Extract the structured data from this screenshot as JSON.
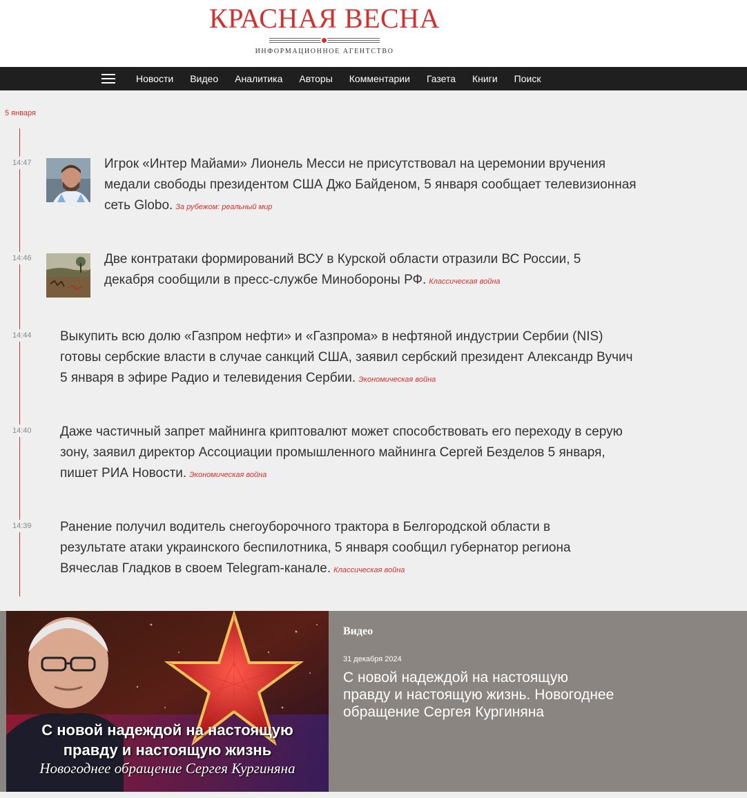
{
  "logo": {
    "title": "КРАСНАЯ ВЕСНА",
    "subtitle": "ИНФОРМАЦИОННОЕ АГЕНТСТВО",
    "accent_color": "#d2302f"
  },
  "nav": {
    "menu_icon": "hamburger-menu-icon",
    "items": [
      "Новости",
      "Видео",
      "Аналитика",
      "Авторы",
      "Комментарии",
      "Газета",
      "Книги",
      "Поиск"
    ]
  },
  "feed": {
    "date": "5 января",
    "items": [
      {
        "time": "14:47",
        "text": "Игрок «Интер Майами» Лионель Месси не присутствовал на церемонии вручения медали свободы президентом США Джо Байденом, 5 января сообщает телевизионная сеть Globo.",
        "tag": "За рубежом: реальный мир",
        "thumbnail": "portrait-photo"
      },
      {
        "time": "14:46",
        "text": "Две контратаки формирований ВСУ в Курской области отразили ВС России, 5 декабря сообщили в пресс-службе Минобороны РФ.",
        "tag": "Классическая война",
        "thumbnail": "battle-painting"
      },
      {
        "time": "14:44",
        "text": "Выкупить всю долю «Газпром нефти» и «Газпрома» в нефтяной индустрии Сербии (NIS) готовы сербские власти в случае санкций США, заявил сербский президент Александр Вучич 5 января в эфире Радио и телевидения Сербии.",
        "tag": "Экономическая война"
      },
      {
        "time": "14:40",
        "text": "Даже частичный запрет майнинга криптовалют может способствовать его переходу в серую зону, заявил директор Ассоциации промышленного майнинга Сергей Безделов 5 января, пишет РИА Новости.",
        "tag": "Экономическая война"
      },
      {
        "time": "14:39",
        "text": "Ранение получил водитель снегоуборочного трактора в Белгородской области в результате атаки украинского беспилотника, 5 января сообщил губернатор региона Вячеслав Гладков в своем Telegram-канале.",
        "tag": "Классическая война"
      }
    ]
  },
  "video": {
    "label": "Видео",
    "date": "31 декабря 2024",
    "title": "С новой надеждой на настоящую правду и настоящую жизнь. Новогоднее обращение Сергея Кургиняна",
    "image_caption_line1": "С новой надеждой на настоящую",
    "image_caption_line2": "правду и настоящую жизнь",
    "image_caption_line3": "Новогоднее обращение Сергея Кургиняна",
    "image_icon": "kremlin-star"
  }
}
